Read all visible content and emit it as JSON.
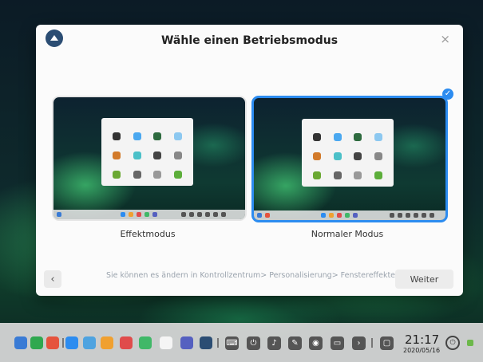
{
  "dialog": {
    "title": "Wähle einen Betriebsmodus",
    "close": "×",
    "check": "✓",
    "options": [
      {
        "label": "Effektmodus",
        "selected": false
      },
      {
        "label": "Normaler Modus",
        "selected": true
      }
    ],
    "hint": "Sie können es ändern in Kontrollzentrum> Personalisierung> Fenstereffekte",
    "back": "‹",
    "next": "Weiter"
  },
  "taskbar": {
    "time": "21:17",
    "date": "2020/05/16",
    "apps": [
      {
        "icon": "launcher-icon",
        "color": "#3a7bd5"
      },
      {
        "icon": "terminal-icon",
        "color": "#2fa84f"
      },
      {
        "icon": "app-store-icon",
        "color": "#e5533d"
      },
      {
        "icon": "file-manager-icon",
        "color": "#2c8cf0"
      },
      {
        "icon": "browser-icon",
        "color": "#4ea3e0"
      },
      {
        "icon": "mail-icon",
        "color": "#f0a030"
      },
      {
        "icon": "music-icon",
        "color": "#e04b4b"
      },
      {
        "icon": "video-icon",
        "color": "#40b868"
      },
      {
        "icon": "calendar-icon",
        "color": "#f5f5f5"
      },
      {
        "icon": "settings-icon",
        "color": "#5560c0"
      },
      {
        "icon": "deepin-icon",
        "color": "#2b4d73"
      }
    ],
    "system": [
      {
        "icon": "keyboard-icon",
        "glyph": "⌨"
      },
      {
        "icon": "usb-icon",
        "glyph": "⏻"
      },
      {
        "icon": "volume-icon",
        "glyph": "♪"
      },
      {
        "icon": "pen-icon",
        "glyph": "✎"
      },
      {
        "icon": "notification-icon",
        "glyph": "◉"
      },
      {
        "icon": "battery-icon",
        "glyph": "▭"
      },
      {
        "icon": "arrow-icon",
        "glyph": "›"
      },
      {
        "icon": "window-icon",
        "glyph": "▢"
      }
    ],
    "power": "⏻"
  }
}
